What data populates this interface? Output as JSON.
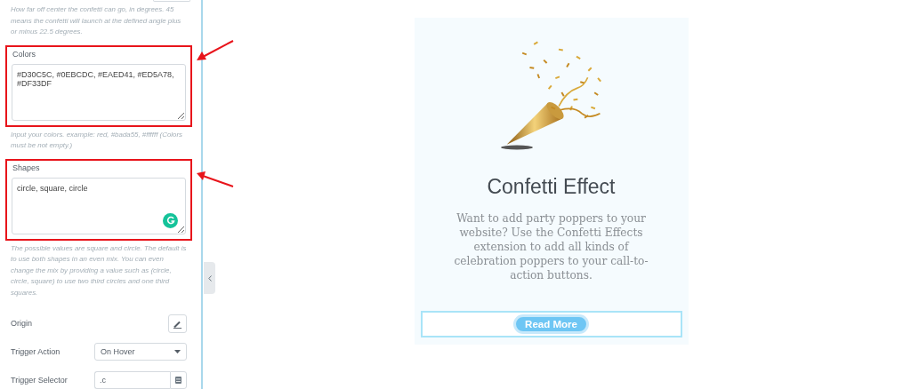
{
  "panel": {
    "top_help": "How far off center the confetti can go, in degrees. 45 means the confetti will launch at the defined angle plus or minus 22.5 degrees.",
    "textareas": [
      {
        "label": "Colors",
        "value": "#D30C5C, #0EBCDC, #EAED41, #ED5A78, #DF33DF",
        "help": "Input your colors. example: red, #bada55, #ffffff (Colors must be not empty.)",
        "highlighted": true,
        "grammar_badge": false
      },
      {
        "label": "Shapes",
        "value": "circle, square, circle",
        "help": "The possible values are square and circle. The default is to use both shapes in an even mix. You can even change the mix by providing a value such as (circle, circle, square) to use two third circles and one third squares.",
        "highlighted": true,
        "grammar_badge": true
      }
    ],
    "controls": [
      {
        "kind": "edit",
        "label": "Origin"
      },
      {
        "kind": "select",
        "label": "Trigger Action",
        "value": "On Hover"
      },
      {
        "kind": "input",
        "label": "Trigger Selector",
        "value": ".c"
      }
    ]
  },
  "card": {
    "title": "Confetti Effect",
    "text": "Want to add party poppers to your website? Use the Confetti Effects extension to add all kinds of celebration poppers to your call-to-action buttons.",
    "button": "Read More"
  }
}
